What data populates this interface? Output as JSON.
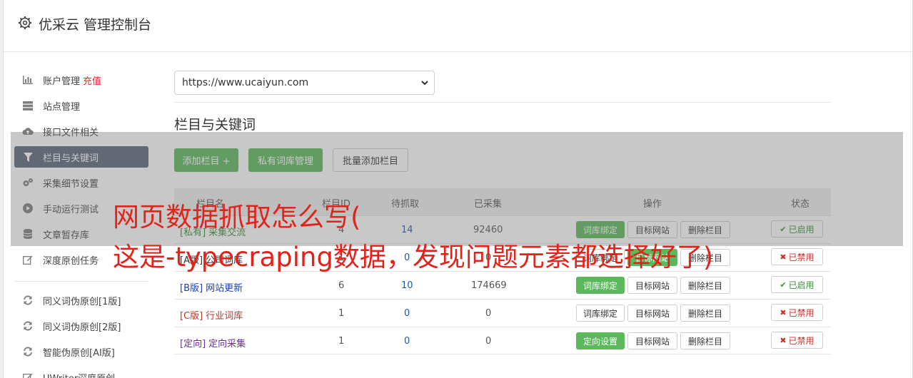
{
  "app": {
    "title": "优采云 管理控制台"
  },
  "sidebar": {
    "items": [
      {
        "label": "账户管理",
        "extra": "充值",
        "icon": "bar-chart-icon"
      },
      {
        "label": "站点管理",
        "icon": "server-icon"
      },
      {
        "label": "接口文件相关",
        "icon": "cloud-upload-icon"
      },
      {
        "label": "栏目与关键词",
        "icon": "filter-icon"
      },
      {
        "label": "采集细节设置",
        "icon": "cogs-icon"
      },
      {
        "label": "手动运行测试",
        "icon": "play-circle-icon"
      },
      {
        "label": "文章暂存库",
        "icon": "database-icon"
      },
      {
        "label": "深度原创任务",
        "icon": "edit-icon"
      }
    ],
    "items2": [
      {
        "label": "同义词伪原创[1版]",
        "icon": "refresh-icon"
      },
      {
        "label": "同义词伪原创[2版]",
        "icon": "refresh-icon"
      },
      {
        "label": "智能伪原创[AI版]",
        "icon": "refresh-icon"
      },
      {
        "label": "UWriter深度原创",
        "icon": "edit-icon"
      }
    ]
  },
  "site_select": {
    "value": "https://www.ucaiyun.com"
  },
  "section": {
    "title": "栏目与关键词",
    "add_column": "添加栏目 +",
    "private_lib": "私有词库管理",
    "batch_add": "批量添加栏目"
  },
  "table": {
    "headers": {
      "name": "栏目名",
      "id": "栏目ID",
      "pending": "待抓取",
      "collected": "已采集",
      "ops": "操作",
      "status": "状态"
    },
    "rows": [
      {
        "tag": "[私有]",
        "name": "采集交流",
        "id": "4",
        "pending": "14",
        "collected": "92460",
        "op1": "词库绑定",
        "op2": "目标网站",
        "op3": "删除栏目",
        "status": "已启用"
      },
      {
        "tag": "[A版]",
        "name": "公司词库",
        "id": "1",
        "pending": "0",
        "collected": "0",
        "op1": "词库绑定",
        "op2": "目标网站",
        "op3": "删除栏目",
        "status": "已禁用"
      },
      {
        "tag": "[B版]",
        "name": "网站更新",
        "id": "6",
        "pending": "10",
        "collected": "174669",
        "op1": "词库绑定",
        "op2": "目标网站",
        "op3": "删除栏目",
        "status": "已启用"
      },
      {
        "tag": "[C版]",
        "name": "行业词库",
        "id": "1",
        "pending": "0",
        "collected": "0",
        "op1": "词库绑定",
        "op2": "目标网站",
        "op3": "删除栏目",
        "status": "已禁用"
      },
      {
        "tag": "[定向]",
        "name": "定向采集",
        "id": "1",
        "pending": "0",
        "collected": "0",
        "op1": "定向设置",
        "op2": "目标网站",
        "op3": "删除栏目",
        "status": "已禁用"
      }
    ]
  },
  "overlay": {
    "line1": "网页数据抓取怎么写(",
    "line2": "这是-typecraping数据，发现问题元素都选择好了)"
  },
  "colors": {
    "active_bg": "#5b6578",
    "green": "#5cb85c",
    "red": "#d9302b",
    "blue": "#1a5aa8"
  }
}
